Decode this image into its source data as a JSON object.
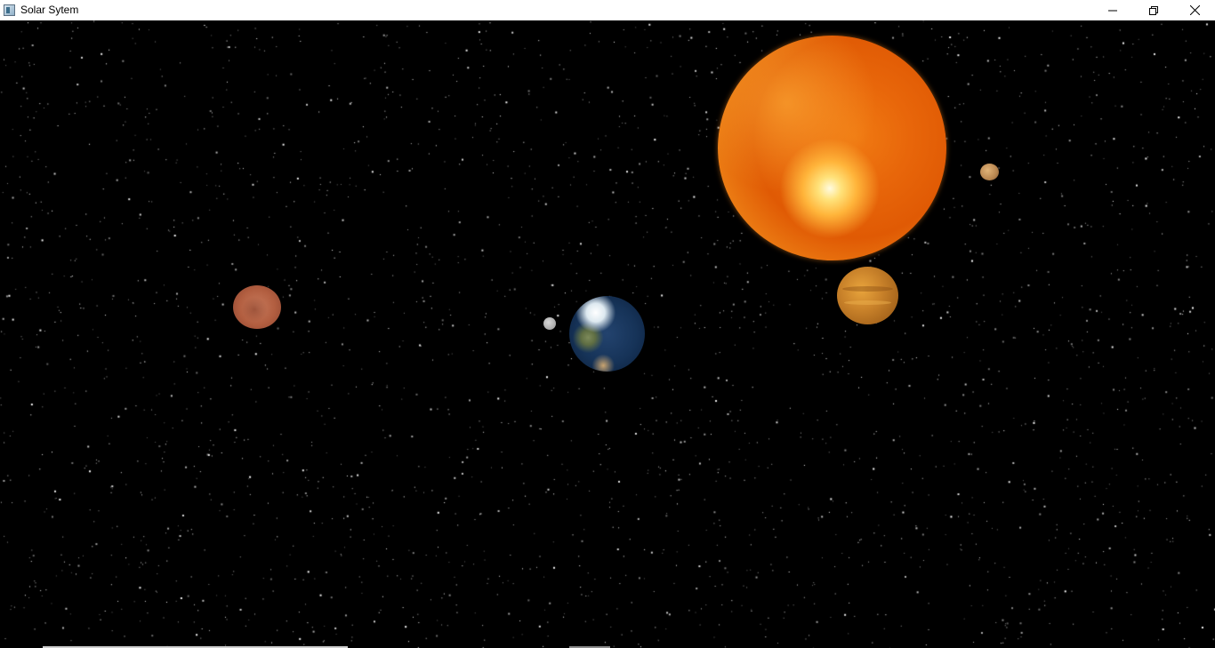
{
  "window": {
    "title": "Solar Sytem",
    "app_icon": "app-window-icon"
  },
  "caption_buttons": {
    "minimize_icon": "minimize-icon",
    "restore_icon": "restore-icon",
    "close_icon": "close-icon"
  },
  "scene": {
    "background_color": "#000000",
    "star_color": "#ffffff",
    "bodies": [
      {
        "name": "sun",
        "color": "#f07a12"
      },
      {
        "name": "jupiter",
        "color": "#c9822a"
      },
      {
        "name": "small-planet",
        "color": "#b88650"
      },
      {
        "name": "earth",
        "color": "#163358"
      },
      {
        "name": "moon",
        "color": "#a8a8a8"
      },
      {
        "name": "mars",
        "color": "#b25e40"
      }
    ]
  }
}
